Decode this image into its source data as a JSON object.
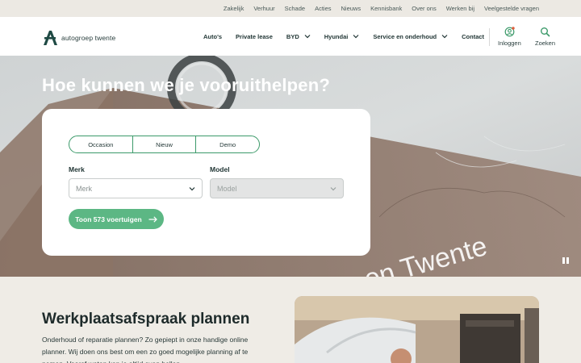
{
  "colors": {
    "accent": "#5cb784",
    "header_bg": "#ffffff",
    "topbar_bg": "#ece9e3",
    "text": "#1d2a2a"
  },
  "topbar": {
    "links": [
      "Zakelijk",
      "Verhuur",
      "Schade",
      "Acties",
      "Nieuws",
      "Kennisbank",
      "Over ons",
      "Werken bij",
      "Veelgestelde vragen"
    ]
  },
  "header": {
    "logo_text": "autogroep twente",
    "nav": [
      {
        "label": "Auto's",
        "dropdown": false
      },
      {
        "label": "Private lease",
        "dropdown": false
      },
      {
        "label": "BYD",
        "dropdown": true
      },
      {
        "label": "Hyundai",
        "dropdown": true
      },
      {
        "label": "Service en onderhoud",
        "dropdown": true
      },
      {
        "label": "Contact",
        "dropdown": false
      }
    ],
    "login_label": "Inloggen",
    "login_icon": "user-circle-icon",
    "search_label": "Zoeken",
    "search_icon": "search-icon"
  },
  "hero": {
    "title": "Hoe kunnen we je vooruithelpen?",
    "sign_text": "en Twente",
    "pause_icon": "pause-icon"
  },
  "search": {
    "tabs": [
      "Occasion",
      "Nieuw",
      "Demo"
    ],
    "brand_label": "Merk",
    "brand_placeholder": "Merk",
    "model_label": "Model",
    "model_placeholder": "Model",
    "cta_label": "Toon 573 voertuigen",
    "cta_icon": "arrow-right-icon"
  },
  "workshop": {
    "title": "Werkplaatsafspraak plannen",
    "text": "Onderhoud of reparatie plannen? Zo gepiept in onze handige online planner. Wij doen ons best om een zo goed mogelijke planning af te nemen. Vooraf weten kan je altijd even bellen."
  }
}
